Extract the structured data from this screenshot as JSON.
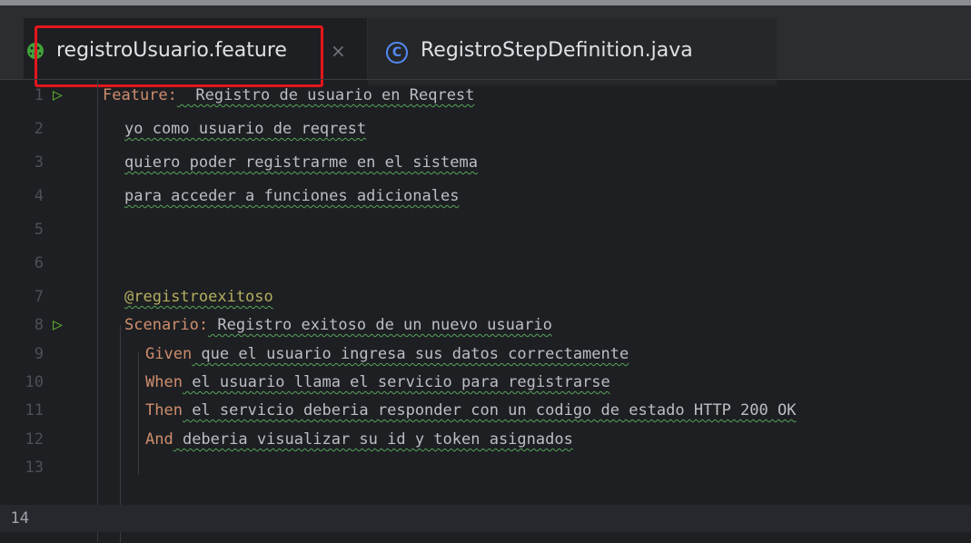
{
  "tabs": [
    {
      "label": "registroUsuario.feature",
      "icon": "cucumber-icon",
      "active": true,
      "close": "×"
    },
    {
      "label": "RegistroStepDefinition.java",
      "icon": "class-icon",
      "active": false,
      "icon_glyph": "C"
    }
  ],
  "colors": {
    "keyword": "#cf8e6d",
    "tag": "#b3ae60",
    "text": "#bcbec4",
    "highlight_box": "#e5161c",
    "run_gutter": "#5fb832"
  },
  "editor": {
    "current_line": 14,
    "lines": [
      {
        "n": "1",
        "kw": "Feature:",
        "text": "  Registro de usuario en Reqrest"
      },
      {
        "n": "2",
        "kw": "",
        "text": "yo como usuario de reqrest"
      },
      {
        "n": "3",
        "kw": "",
        "text": "quiero poder registrarme en el sistema"
      },
      {
        "n": "4",
        "kw": "",
        "text": "para acceder a funciones adicionales"
      },
      {
        "n": "5",
        "kw": "",
        "text": ""
      },
      {
        "n": "6",
        "kw": "",
        "text": ""
      },
      {
        "n": "7",
        "kw": "",
        "text": "@registroexitoso"
      },
      {
        "n": "8",
        "kw": "Scenario:",
        "text": " Registro exitoso de un nuevo usuario"
      },
      {
        "n": "9",
        "kw": "Given",
        "text": " que el usuario ingresa sus datos correctamente"
      },
      {
        "n": "10",
        "kw": "When",
        "text": " el usuario llama el servicio para registrarse"
      },
      {
        "n": "11",
        "kw": "Then",
        "text": " el servicio deberia responder con un codigo de estado HTTP 200 OK"
      },
      {
        "n": "12",
        "kw": "And",
        "text": " deberia visualizar su id y token asignados"
      },
      {
        "n": "13",
        "kw": "",
        "text": ""
      },
      {
        "n": "14",
        "kw": "",
        "text": ""
      }
    ]
  }
}
